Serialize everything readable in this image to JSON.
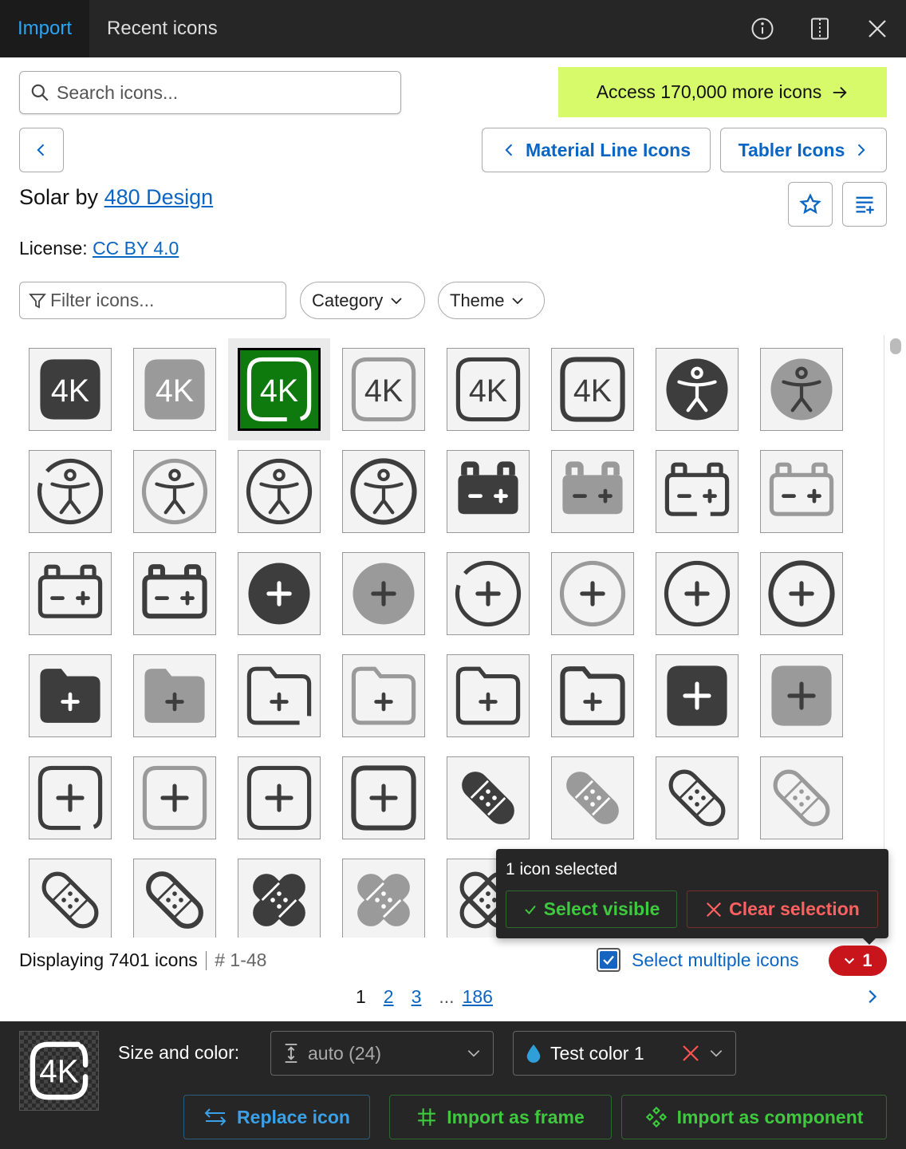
{
  "tabs": [
    {
      "label": "Import",
      "active": true
    },
    {
      "label": "Recent icons",
      "active": false
    }
  ],
  "top_icons": [
    "info-icon",
    "split-view-icon",
    "close-icon"
  ],
  "search": {
    "placeholder": "Search icons..."
  },
  "access_button": {
    "label": "Access 170,000 more icons",
    "color": "#d6fa6a"
  },
  "nav": {
    "prev_set": "Material Line Icons",
    "next_set": "Tabler Icons"
  },
  "iconset": {
    "name_prefix": "Solar by",
    "author": "480 Design",
    "license_label": "License:",
    "license": "CC BY 4.0"
  },
  "filter": {
    "placeholder": "Filter icons...",
    "category_label": "Category",
    "theme_label": "Theme"
  },
  "icons": [
    "4k-bold",
    "4k-bold-duotone",
    "4k-broken",
    "4k-line-duotone",
    "4k-linear",
    "4k-outline",
    "accessibility-bold",
    "accessibility-bold-duotone",
    "accessibility-broken",
    "accessibility-line-duotone",
    "accessibility-linear",
    "accessibility-outline",
    "accumulator-bold",
    "accumulator-bold-duotone",
    "accumulator-broken",
    "accumulator-line-duotone",
    "accumulator-linear",
    "accumulator-outline",
    "add-circle-bold",
    "add-circle-bold-duotone",
    "add-circle-broken",
    "add-circle-line-duotone",
    "add-circle-linear",
    "add-circle-outline",
    "add-folder-bold",
    "add-folder-bold-duotone",
    "add-folder-broken",
    "add-folder-line-duotone",
    "add-folder-linear",
    "add-folder-outline",
    "add-square-bold",
    "add-square-bold-duotone",
    "add-square-broken",
    "add-square-line-duotone",
    "add-square-linear",
    "add-square-outline",
    "adhesive-plaster-bold",
    "adhesive-plaster-bold-duotone",
    "adhesive-plaster-broken",
    "adhesive-plaster-line-duotone",
    "adhesive-plaster-linear",
    "adhesive-plaster-outline",
    "adhesive-plaster-2-bold",
    "adhesive-plaster-2-bold-duotone",
    "adhesive-plaster-2-broken"
  ],
  "selected_icon_index": 2,
  "selection_popover": {
    "title": "1 icon selected",
    "select_visible": "Select visible",
    "clear_selection": "Clear selection"
  },
  "status": {
    "displaying": "Displaying 7401 icons",
    "range": "# 1-48"
  },
  "multi_select": {
    "label": "Select multiple icons",
    "checked": true,
    "count": "1"
  },
  "pagination": {
    "current": "1",
    "pages": [
      "2",
      "3"
    ],
    "ellipsis": "...",
    "last": "186"
  },
  "bottom": {
    "size_color_label": "Size and color:",
    "size_value": "auto (24)",
    "color_value": "Test color 1",
    "replace_label": "Replace icon",
    "frame_label": "Import as frame",
    "component_label": "Import as component"
  },
  "colors": {
    "accent_blue": "#0b65c2",
    "selected_bg": "#0e7a0d",
    "badge_red": "#c8141b",
    "dark_bg": "#262626",
    "green": "#3ec93e"
  }
}
